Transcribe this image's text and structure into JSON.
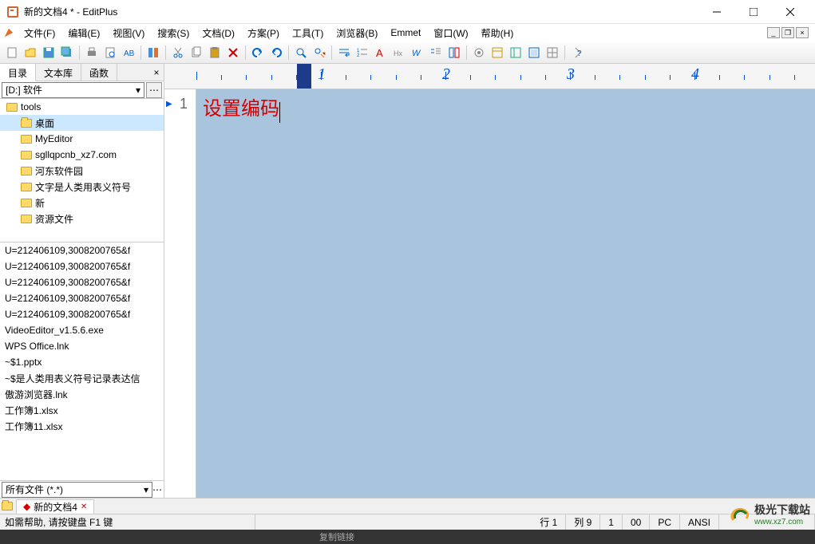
{
  "window": {
    "title": "新的文档4 * - EditPlus"
  },
  "menus": [
    "文件(F)",
    "编辑(E)",
    "视图(V)",
    "搜索(S)",
    "文档(D)",
    "方案(P)",
    "工具(T)",
    "浏览器(B)",
    "Emmet",
    "窗口(W)",
    "帮助(H)"
  ],
  "sidebar": {
    "tabs": [
      "目录",
      "文本库",
      "函数"
    ],
    "drive": "[D:] 软件",
    "folders": [
      {
        "name": "tools",
        "level": 0,
        "sel": false
      },
      {
        "name": "桌面",
        "level": 1,
        "sel": true
      },
      {
        "name": "MyEditor",
        "level": 1,
        "sel": false
      },
      {
        "name": "sgllqpcnb_xz7.com",
        "level": 1,
        "sel": false
      },
      {
        "name": "河东软件园",
        "level": 1,
        "sel": false
      },
      {
        "name": "文字是人类用表义符号",
        "level": 1,
        "sel": false
      },
      {
        "name": "新",
        "level": 1,
        "sel": false
      },
      {
        "name": "资源文件",
        "level": 1,
        "sel": false
      }
    ],
    "files": [
      "U=212406109,3008200765&f",
      "U=212406109,3008200765&f",
      "U=212406109,3008200765&f",
      "U=212406109,3008200765&f",
      "U=212406109,3008200765&f",
      "VideoEditor_v1.5.6.exe",
      "WPS Office.lnk",
      "~$1.pptx",
      "~$是人类用表义符号记录表达信",
      "傲游浏览器.lnk",
      "工作簿1.xlsx",
      "工作簿11.xlsx"
    ],
    "filter": "所有文件 (*.*)"
  },
  "editor": {
    "ruler_marks": [
      1,
      2,
      3,
      4
    ],
    "line": "1",
    "text": "设置编码"
  },
  "doc_tab": "新的文档4",
  "status": {
    "help": "如需帮助, 请按键盘 F1 键",
    "row": "行 1",
    "col": "列 9",
    "c3": "1",
    "c4": "00",
    "c5": "PC",
    "c6": "ANSI"
  },
  "watermark": {
    "name": "极光下载站",
    "url": "www.xz7.com"
  },
  "footer": "复制链接"
}
